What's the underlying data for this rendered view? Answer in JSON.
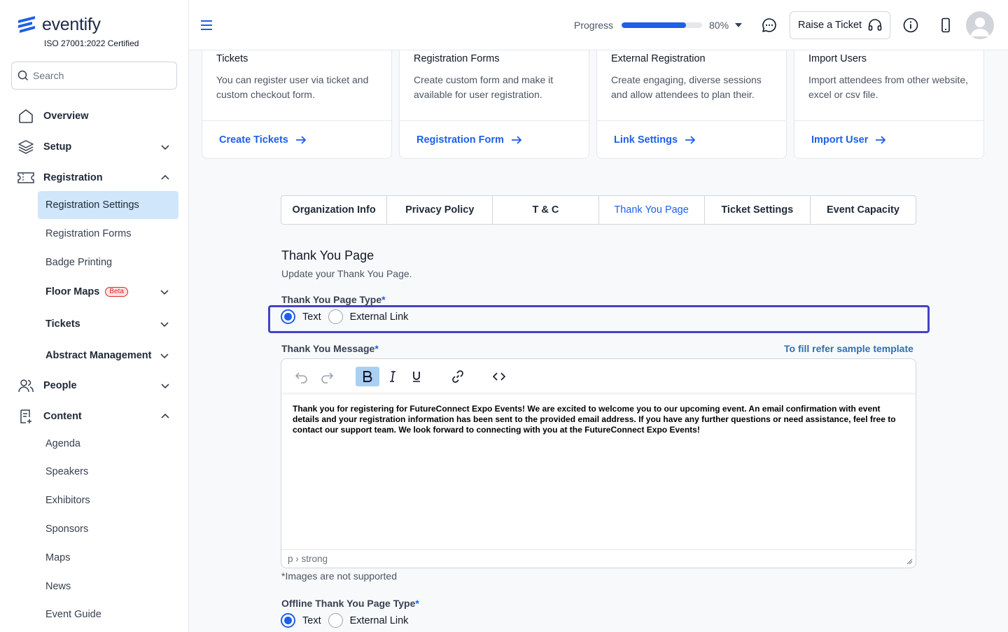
{
  "brand": {
    "name": "eventify",
    "certification": "ISO 27001:2022 Certified",
    "color": "#1d5fe8"
  },
  "search": {
    "placeholder": "Search"
  },
  "sidebar": {
    "overview": "Overview",
    "setup": "Setup",
    "registration": "Registration",
    "registration_items": [
      "Registration Settings",
      "Registration Forms",
      "Badge Printing"
    ],
    "floor_maps": "Floor Maps",
    "beta": "Beta",
    "tickets": "Tickets",
    "abstract": "Abstract Management",
    "people": "People",
    "content": "Content",
    "content_items": [
      "Agenda",
      "Speakers",
      "Exhibitors",
      "Sponsors",
      "Maps",
      "News",
      "Event Guide"
    ]
  },
  "header": {
    "progress_label": "Progress",
    "progress_value": 80,
    "progress_text": "80%",
    "raise_ticket": "Raise a Ticket"
  },
  "cards": [
    {
      "title": "Tickets",
      "desc": "You can register user via ticket and custom checkout form.",
      "link": "Create Tickets"
    },
    {
      "title": "Registration Forms",
      "desc": "Create custom form and make it available for user registration.",
      "link": "Registration Form"
    },
    {
      "title": "External Registration",
      "desc": "Create engaging, diverse sessions and allow attendees to plan their.",
      "link": "Link Settings"
    },
    {
      "title": "Import Users",
      "desc": "Import attendees from other website, excel or csv file.",
      "link": "Import User"
    }
  ],
  "tabs": [
    "Organization Info",
    "Privacy Policy",
    "T & C",
    "Thank You Page",
    "Ticket Settings",
    "Event Capacity"
  ],
  "active_tab": "Thank You Page",
  "section": {
    "title": "Thank You Page",
    "subtitle": "Update your Thank You Page.",
    "type_label": "Thank You Page Type",
    "required_mark": "*",
    "option_text": "Text",
    "option_link": "External Link",
    "message_label": "Thank You Message",
    "sample_link": "To fill refer sample template",
    "message": "Thank you for registering for FutureConnect Expo Events! We are excited to welcome you to our upcoming event. An email confirmation with event details and your registration information has been sent to the provided email address. If you have any further questions or need assistance, feel free to contact our support team. We look forward to connecting with you at the FutureConnect Expo Events!",
    "status_path": "p › strong",
    "note": "*Images are not supported",
    "offline_label": "Offline Thank You Page Type"
  }
}
